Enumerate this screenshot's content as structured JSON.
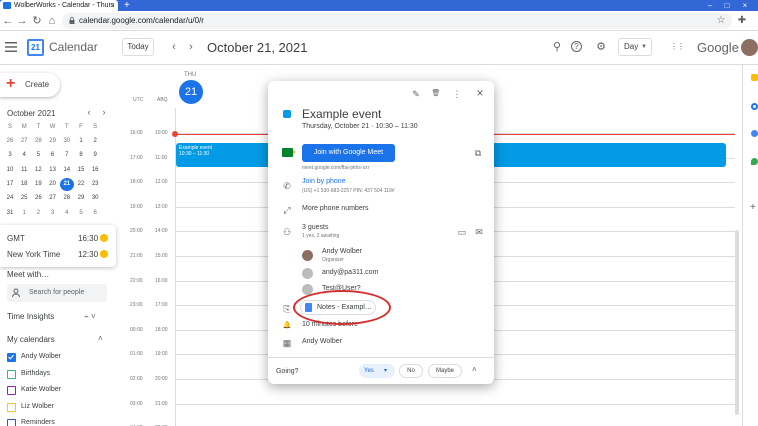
{
  "browser": {
    "tab_title": "WolberWorks - Calendar - Thurs",
    "tab_close": "×",
    "new_tab": "+",
    "url": "calendar.google.com/calendar/u/0/r",
    "back": "←",
    "forward": "→",
    "reload": "↻",
    "home": "⌂",
    "star": "☆",
    "extensions": "✚",
    "settings": "⚙",
    "win_min": "–",
    "win_max": "□",
    "win_close": "×"
  },
  "header": {
    "logo_day": "21",
    "app_title": "Calendar",
    "today_label": "Today",
    "prev": "‹",
    "next": "›",
    "date_title": "October 21, 2021",
    "search": "⚲",
    "help": "?",
    "settings": "⚙",
    "view_label": "Day",
    "view_caret": "▼",
    "apps": "⋮⋮",
    "brand": "Google"
  },
  "sidebar": {
    "create_label": "Create",
    "create_plus": "+",
    "mini_title": "October 2021",
    "mini_prev": "‹",
    "mini_next": "›",
    "weekdays": [
      "S",
      "M",
      "T",
      "W",
      "T",
      "F",
      "S"
    ],
    "weeks": [
      [
        "26",
        "27",
        "28",
        "29",
        "30",
        "1",
        "2"
      ],
      [
        "3",
        "4",
        "5",
        "6",
        "7",
        "8",
        "9"
      ],
      [
        "10",
        "11",
        "12",
        "13",
        "14",
        "15",
        "16"
      ],
      [
        "17",
        "18",
        "19",
        "20",
        "21",
        "22",
        "23"
      ],
      [
        "24",
        "25",
        "26",
        "27",
        "28",
        "29",
        "30"
      ],
      [
        "31",
        "1",
        "2",
        "3",
        "4",
        "5",
        "6"
      ]
    ],
    "selected_day": "21",
    "timezones": [
      {
        "label": "GMT",
        "time": "16:30"
      },
      {
        "label": "New York Time",
        "time": "12:30"
      }
    ],
    "meet_with": "Meet with…",
    "search_people_placeholder": "Search for people",
    "time_insights": "Time Insights",
    "time_insights_icon": "⌁ ˅",
    "my_calendars": "My calendars",
    "my_calendars_caret": "˄",
    "calendars": [
      {
        "name": "Andy Wolber",
        "color": "#1a73e8",
        "checked": true
      },
      {
        "name": "Birthdays",
        "color": "#33b679",
        "checked": false
      },
      {
        "name": "Katie Wolber",
        "color": "#8e24aa",
        "checked": false
      },
      {
        "name": "Liz Wolber",
        "color": "#e4c441",
        "checked": false
      },
      {
        "name": "Reminders",
        "color": "#3f51b5",
        "checked": false
      }
    ]
  },
  "grid": {
    "day_label": "THU",
    "day_number": "21",
    "tz1": "UTC",
    "tz2": "ABQ",
    "rows": [
      {
        "utc": "16:00",
        "local": "10:00"
      },
      {
        "utc": "17:00",
        "local": "11:00"
      },
      {
        "utc": "18:00",
        "local": "12:00"
      },
      {
        "utc": "19:00",
        "local": "13:00"
      },
      {
        "utc": "20:00",
        "local": "14:00"
      },
      {
        "utc": "21:00",
        "local": "15:00"
      },
      {
        "utc": "22:00",
        "local": "16:00"
      },
      {
        "utc": "23:00",
        "local": "17:00"
      },
      {
        "utc": "00:00",
        "local": "18:00"
      },
      {
        "utc": "01:00",
        "local": "19:00"
      },
      {
        "utc": "02:00",
        "local": "20:00"
      },
      {
        "utc": "03:00",
        "local": "21:00"
      },
      {
        "utc": "04:00",
        "local": "22:00"
      }
    ],
    "event_title": "Example event",
    "event_time": "10:30 – 11:30"
  },
  "popup": {
    "edit": "✎",
    "delete": "🗑",
    "more": "⋮",
    "close": "×",
    "title": "Example event",
    "when": "Thursday, October 21  ·  10:30 – 11:30",
    "join_meet": "Join with Google Meet",
    "meet_url": "meet.google.com/fba-pkhs-sxr",
    "copy": "⧉",
    "phone_icon": "✆",
    "join_phone": "Join by phone",
    "phone_details": "(US) +1 530-683-2257 PIN: 437 504 119#",
    "more_phones_icon": "⤢",
    "more_phones": "More phone numbers",
    "guests_icon": "⚇",
    "guests_count": "3 guests",
    "guests_status": "1 yes, 2 awaiting",
    "message": "▭",
    "mail": "✉",
    "guests": [
      {
        "name": "Andy Wolber",
        "role": "Organizer"
      },
      {
        "name": "andy@pa311.com",
        "role": ""
      },
      {
        "name": "Test@User?",
        "role": ""
      }
    ],
    "clip_icon": "⎘",
    "notes_label": "Notes - Exampl…",
    "bell_icon": "🔔",
    "reminder": "10 minutes before",
    "cal_icon": "▦",
    "organizer": "Andy Wolber",
    "going": "Going?",
    "yes": "Yes",
    "yes_caret": "▾",
    "no": "No",
    "maybe": "Maybe",
    "going_caret": "˄"
  },
  "colors": {
    "accent": "#1a73e8",
    "event": "#039be5",
    "now": "#ea4335",
    "annotation": "#d32f2f"
  }
}
